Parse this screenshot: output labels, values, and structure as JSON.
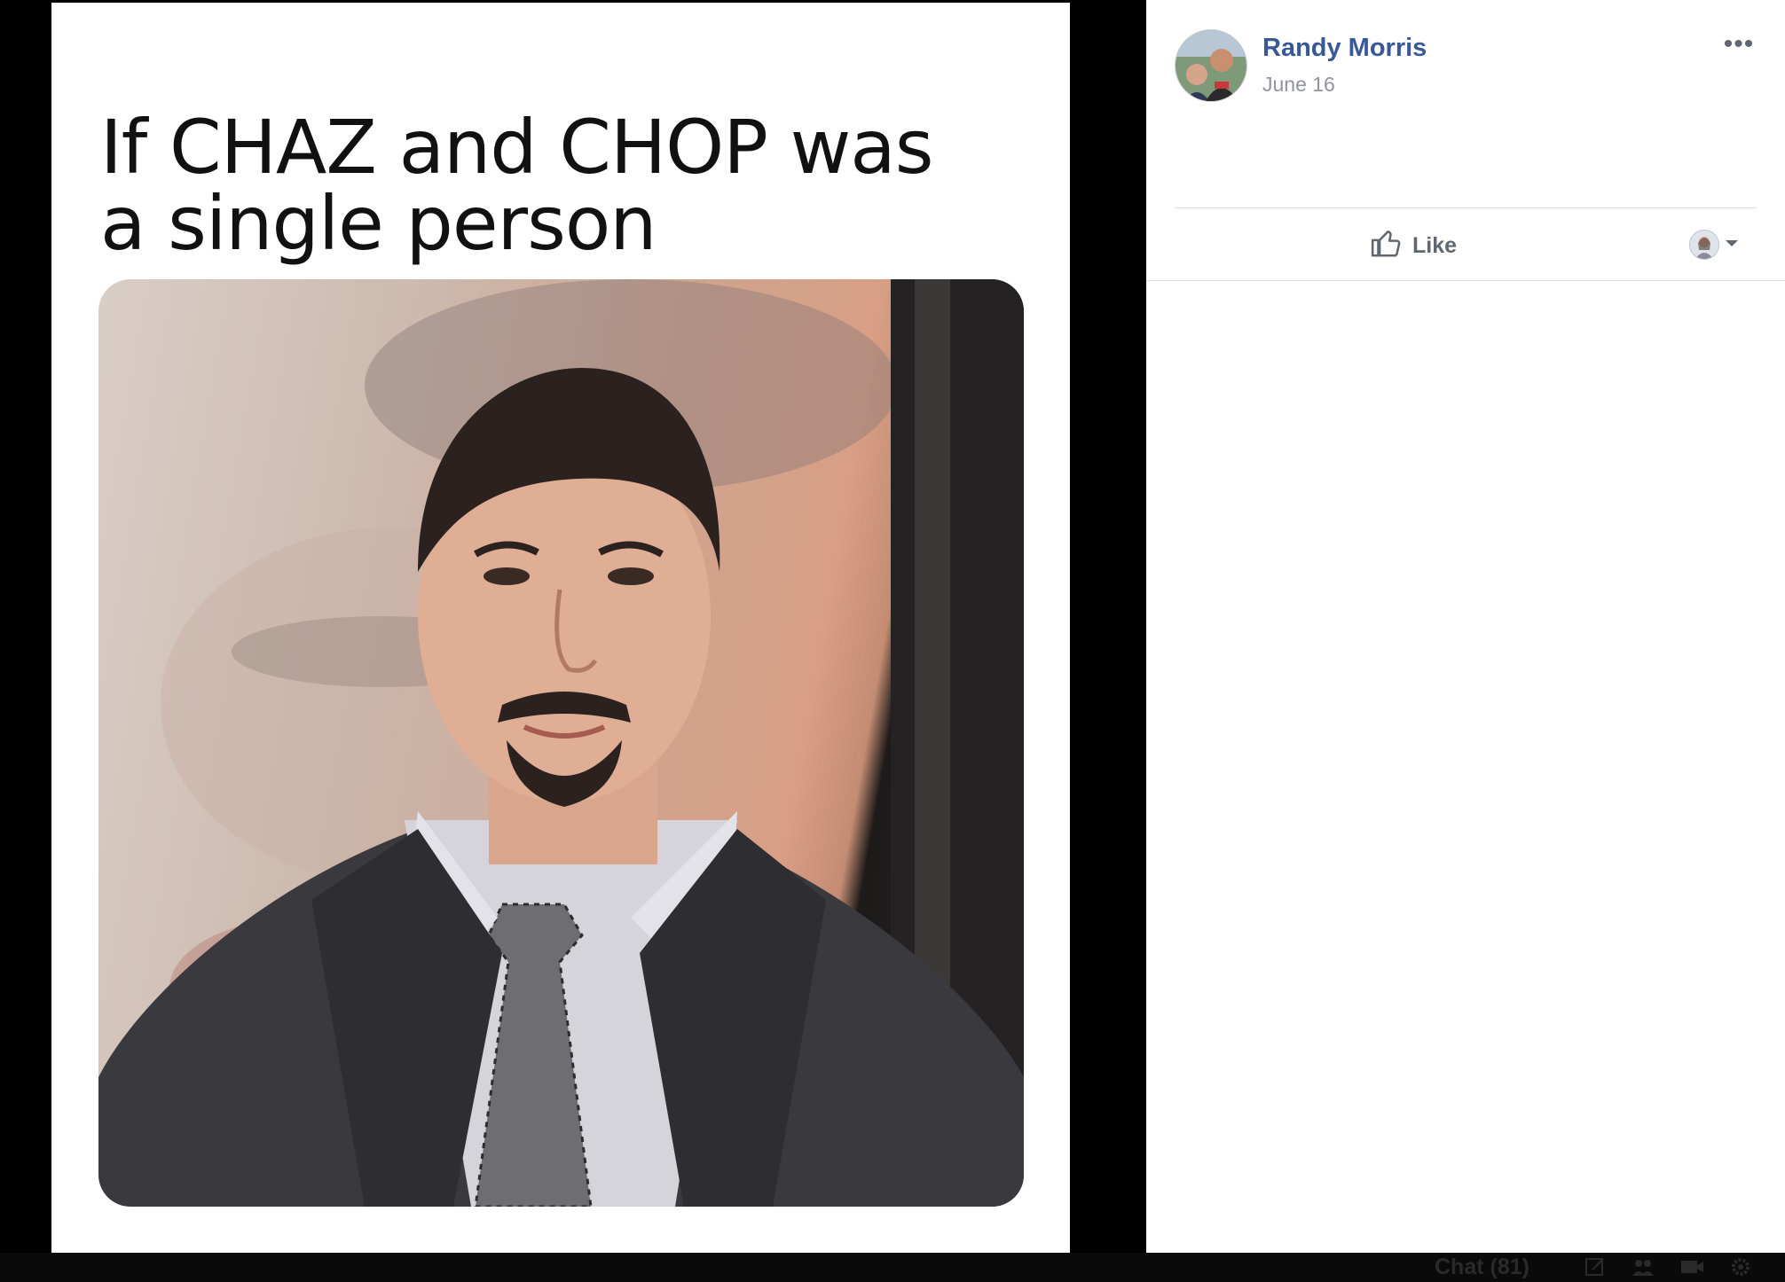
{
  "meme": {
    "caption": "If CHAZ and CHOP was\na single person"
  },
  "post": {
    "author_name": "Randy Morris",
    "date": "June 16",
    "more_label": "•••",
    "like_label": "Like"
  },
  "chat": {
    "label": "Chat (81)"
  },
  "colors": {
    "link_blue": "#385898",
    "meta_gray": "#90949c",
    "button_gray": "#606770",
    "divider": "#dadde1"
  }
}
